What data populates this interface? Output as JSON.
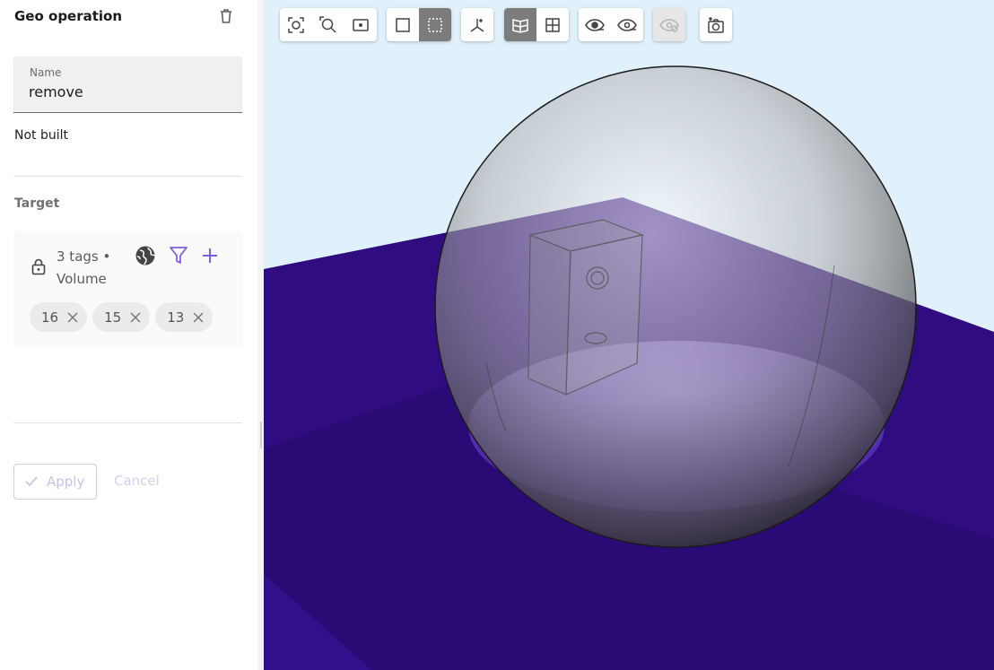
{
  "panel": {
    "title": "Geo operation",
    "name_label": "Name",
    "name_value": "remove",
    "status": "Not built",
    "target_label": "Target",
    "tags_count": "3 tags • Volume",
    "chips": [
      "16",
      "15",
      "13"
    ],
    "apply_label": "Apply",
    "cancel_label": "Cancel"
  },
  "icons": {
    "delete": "trash-icon",
    "lock": "lock-icon",
    "globe": "globe-icon",
    "filter": "filter-icon",
    "add": "plus-icon",
    "chip_remove": "close-icon",
    "apply": "check-icon"
  },
  "toolbar": {
    "groups": [
      [
        "zoom-fit-icon",
        "zoom-box-icon",
        "zoom-select-icon"
      ],
      [
        "select-single-icon",
        "select-box-icon"
      ],
      [
        "axes-icon"
      ],
      [
        "view-section-icon",
        "view-grid-icon"
      ],
      [
        "show-icon",
        "hide-icon"
      ],
      [
        "show-all-icon"
      ],
      [
        "screenshot-icon"
      ]
    ],
    "active": [
      "select-box-icon",
      "view-section-icon"
    ],
    "disabled": [
      "show-all-icon"
    ]
  },
  "colors": {
    "accent": "#7b5fe0",
    "background_sky": "#e1f1fb",
    "plane": "#2f0d80",
    "active_tool": "#7c7c7c"
  }
}
